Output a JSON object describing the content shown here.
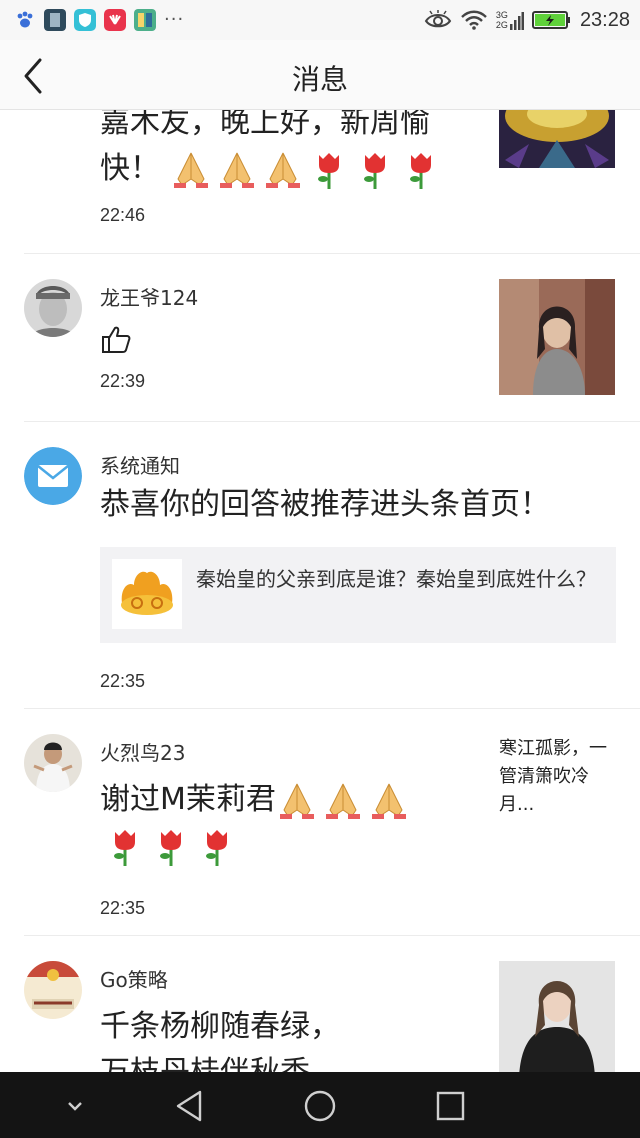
{
  "status_bar": {
    "time": "23:28",
    "more_indicator": "···",
    "network_top": "3G",
    "network_bottom": "2G",
    "icons": [
      "paw-icon",
      "app-thumbnail-icon",
      "shield-app-icon",
      "huawei-app-icon",
      "reader-app-icon",
      "eye-icon",
      "wifi-icon",
      "signal-icon",
      "battery-charging-icon"
    ]
  },
  "header": {
    "title": "消息",
    "back_icon": "chevron-left-icon"
  },
  "messages": [
    {
      "body_line1": "嘉木友，晚上好，新周愉",
      "body_line2": "快！",
      "emojis": [
        "folded-hands",
        "folded-hands",
        "folded-hands",
        "rose",
        "rose",
        "rose"
      ],
      "time": "22:46"
    },
    {
      "name": "龙王爷124",
      "like_icon": "thumbs-up-icon",
      "time": "22:39"
    },
    {
      "name": "系统通知",
      "body": "恭喜你的回答被推荐进头条首页！",
      "quote_text": "秦始皇的父亲到底是谁？秦始皇到底姓什么？",
      "time": "22:35"
    },
    {
      "name": "火烈鸟23",
      "body": "谢过M茉莉君",
      "emojis_line1": [
        "folded-hands",
        "folded-hands",
        "folded-hands"
      ],
      "emojis_line2": [
        "rose",
        "rose",
        "rose"
      ],
      "reply_snippet": "寒江孤影，一管清箫吹冷月...",
      "time": "22:35"
    },
    {
      "name": "Go策略",
      "body_line1": "千条杨柳随春绿，",
      "body_line2": "万枝丹桂伴秋香"
    }
  ],
  "colors": {
    "system_notice_avatar": "#4aa8e6",
    "quote_background": "#f2f2f4",
    "navbar": "#141414"
  }
}
